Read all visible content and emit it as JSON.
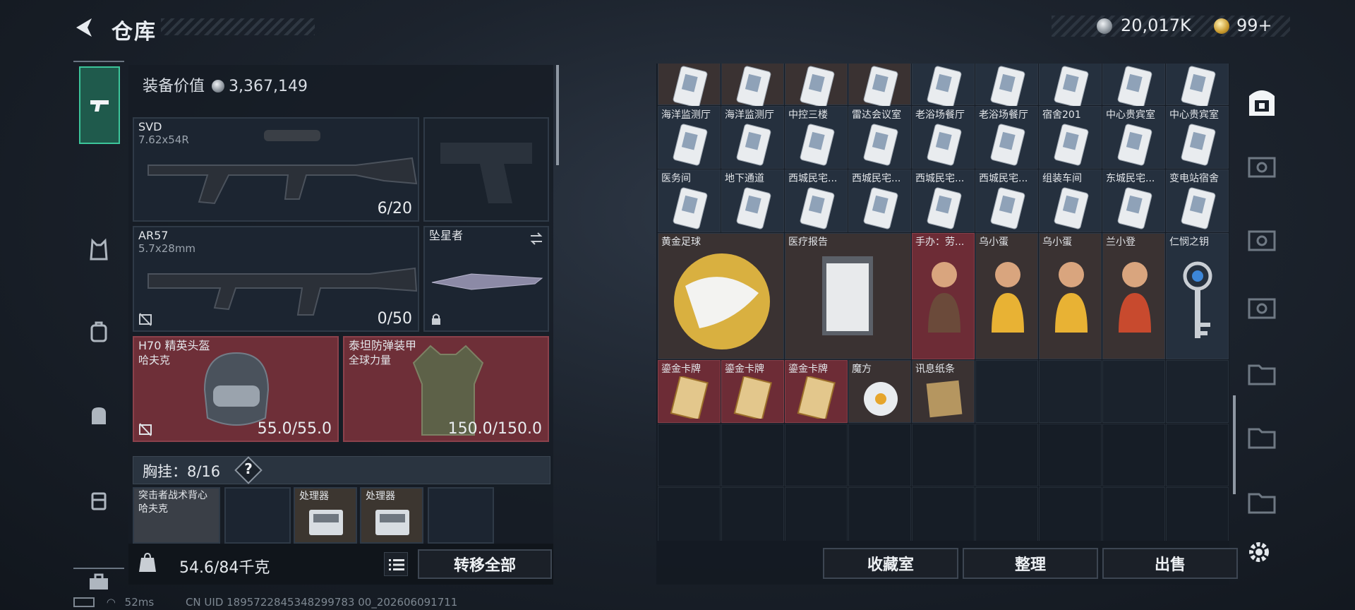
{
  "header": {
    "title": "仓库",
    "currency_silver": "20,017K",
    "currency_gold": "99+"
  },
  "left_nav": {
    "items": [
      "weapon-icon",
      "vest-icon",
      "backpack-icon",
      "bag-icon",
      "case-icon",
      "toolbox-icon"
    ]
  },
  "equipment": {
    "value_label": "装备价值",
    "value": "3,367,149",
    "primary": {
      "name": "SVD",
      "ammo": "7.62x54R",
      "count": "6/20"
    },
    "secondary": {
      "name": "AR57",
      "ammo": "5.7x28mm",
      "count": "0/50"
    },
    "melee": {
      "name": "坠星者"
    },
    "helmet": {
      "name": "H70 精英头盔",
      "maker": "哈夫克",
      "durability": "55.0/55.0"
    },
    "armor": {
      "name": "泰坦防弹装甲",
      "maker": "全球力量",
      "durability": "150.0/150.0"
    },
    "rig": {
      "label": "胸挂：8/16",
      "help": "?",
      "items": [
        {
          "name": "突击者战术背心",
          "maker": "哈夫克"
        },
        {
          "name": ""
        },
        {
          "name": "处理器"
        },
        {
          "name": "处理器"
        },
        {
          "name": ""
        }
      ]
    },
    "weight": "54.6/84千克",
    "transfer_all": "转移全部"
  },
  "inventory": {
    "row1": [
      "",
      "",
      "",
      "",
      "",
      "",
      "",
      "",
      ""
    ],
    "row2": [
      "海洋监测厅",
      "海洋监测厅",
      "中控三楼",
      "雷达会议室",
      "老浴场餐厅",
      "老浴场餐厅",
      "宿舍201",
      "中心贵宾室",
      "中心贵宾室"
    ],
    "row3": [
      "医务间",
      "地下通道",
      "西城民宅...",
      "西城民宅...",
      "西城民宅...",
      "西城民宅...",
      "组装车间",
      "东城民宅...",
      "变电站宿舍"
    ],
    "row4": [
      "黄金足球",
      "医疗报告",
      "手办：劳...",
      "乌小蛋",
      "乌小蛋",
      "兰小登",
      "仁悯之钥"
    ],
    "row5": [
      "鎏金卡牌",
      "鎏金卡牌",
      "鎏金卡牌",
      "魔方",
      "讯息纸条"
    ]
  },
  "actions": {
    "collection": "收藏室",
    "sort": "整理",
    "sell": "出售"
  },
  "status_bar": {
    "ping": "52ms",
    "uid": "CN UID 1895722845348299783 00_202606091711"
  }
}
